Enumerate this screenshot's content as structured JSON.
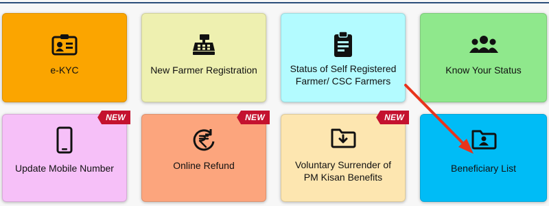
{
  "tiles": [
    {
      "label": "e-KYC",
      "icon": "id-card-icon",
      "color": "#fba500",
      "new": false
    },
    {
      "label": "New Farmer Registration",
      "icon": "cash-register-icon",
      "color": "#eef0b0",
      "new": false
    },
    {
      "label": "Status of Self Registered Farmer/ CSC Farmers",
      "icon": "clipboard-icon",
      "color": "#b3fbff",
      "new": false
    },
    {
      "label": "Know Your Status",
      "icon": "users-group-icon",
      "color": "#8fe88c",
      "new": false
    },
    {
      "label": "Update Mobile Number",
      "icon": "mobile-phone-icon",
      "color": "#f6c0f8",
      "new": true
    },
    {
      "label": "Online Refund",
      "icon": "rupee-refund-icon",
      "color": "#fca57d",
      "new": true
    },
    {
      "label": "Voluntary Surrender of PM Kisan Benefits",
      "icon": "folder-download-icon",
      "color": "#fde6b0",
      "new": true
    },
    {
      "label": "Beneficiary List",
      "icon": "folder-user-icon",
      "color": "#00bcf6",
      "new": false
    }
  ],
  "badge_text": "NEW",
  "annotation": {
    "arrow_color": "#e8341c"
  }
}
